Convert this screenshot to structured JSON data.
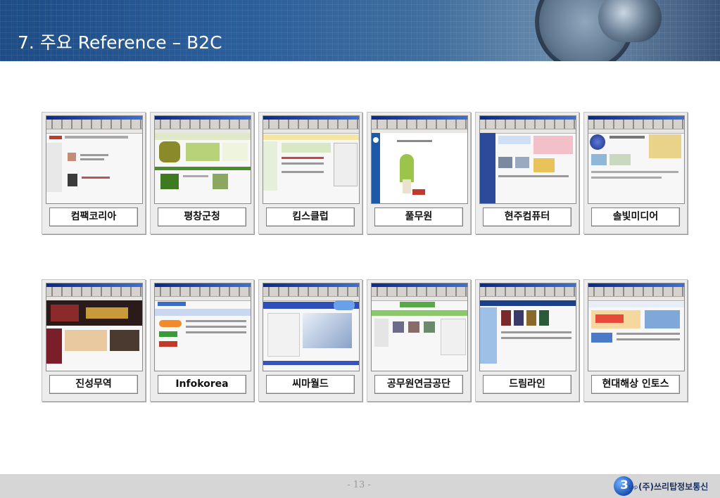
{
  "header": {
    "title": "7. 주요 Reference – B2C"
  },
  "references": [
    {
      "label": "컴팩코리아"
    },
    {
      "label": "평창군청"
    },
    {
      "label": "킴스클럽"
    },
    {
      "label": "풀무원"
    },
    {
      "label": "현주컴퓨터"
    },
    {
      "label": "솔빛미디어"
    },
    {
      "label": "진성무역"
    },
    {
      "label": "Infokorea"
    },
    {
      "label": "씨마월드"
    },
    {
      "label": "공무원연금공단"
    },
    {
      "label": "드림라인"
    },
    {
      "label": "현대해상 인토스"
    }
  ],
  "footer": {
    "page_number": "- 13 -",
    "logo_number": "3",
    "logo_sub": "top",
    "company": "(주)쓰리탑정보통신"
  },
  "colors": {
    "header_blue": "#2b5f9c",
    "footer_gray": "#d6d6d6",
    "logo_blue": "#1a4fb5"
  }
}
